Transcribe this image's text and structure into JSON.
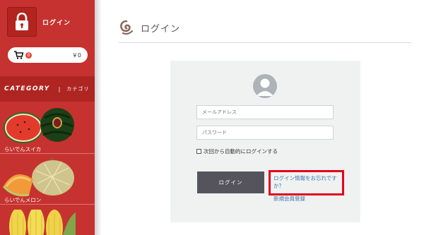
{
  "sidebar": {
    "login_label": "ログイン",
    "cart": {
      "count": "0",
      "price": "￥0"
    },
    "category": {
      "title": "CATEGORY",
      "separator": "|",
      "subtitle": "カテゴリ"
    },
    "products": [
      {
        "label": "らいでんスイカ",
        "image": "watermelon"
      },
      {
        "label": "らいでんメロン",
        "image": "melon"
      },
      {
        "label": "",
        "image": "corn"
      }
    ]
  },
  "header": {
    "title": "ログイン"
  },
  "form": {
    "email_placeholder": "メールアドレス",
    "password_placeholder": "パスワード",
    "remember_label": "次回から自動的にログインする",
    "login_button": "ログイン",
    "forgot_link": "ログイン情報をお忘れですか？",
    "register_link": "新規会員登録"
  },
  "colors": {
    "sidebar": "#c6322f",
    "button": "#55545d",
    "link": "#3e76a8",
    "highlight": "#e3001b"
  }
}
